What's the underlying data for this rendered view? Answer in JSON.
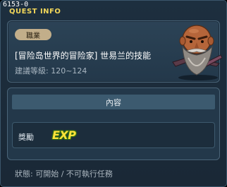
{
  "window": {
    "quest_id": "6153-0",
    "title": "QUEST INFO"
  },
  "quest": {
    "job_tag": "職業",
    "name": "[冒险岛世界的冒险家] 世易兰的技能",
    "recommended_level": "建議等級: 120~124"
  },
  "content": {
    "header": "內容",
    "reward_label": "獎勵",
    "reward_exp": "EXP"
  },
  "status_text": "狀態: 可開始 / 不可執行任務",
  "colors": {
    "title": "#f2d75a",
    "panel": "#23384a",
    "job_pill": "#c2ae8a",
    "exp": "#ffe23a"
  },
  "icons": {
    "npc": "npc-portrait-icon"
  }
}
